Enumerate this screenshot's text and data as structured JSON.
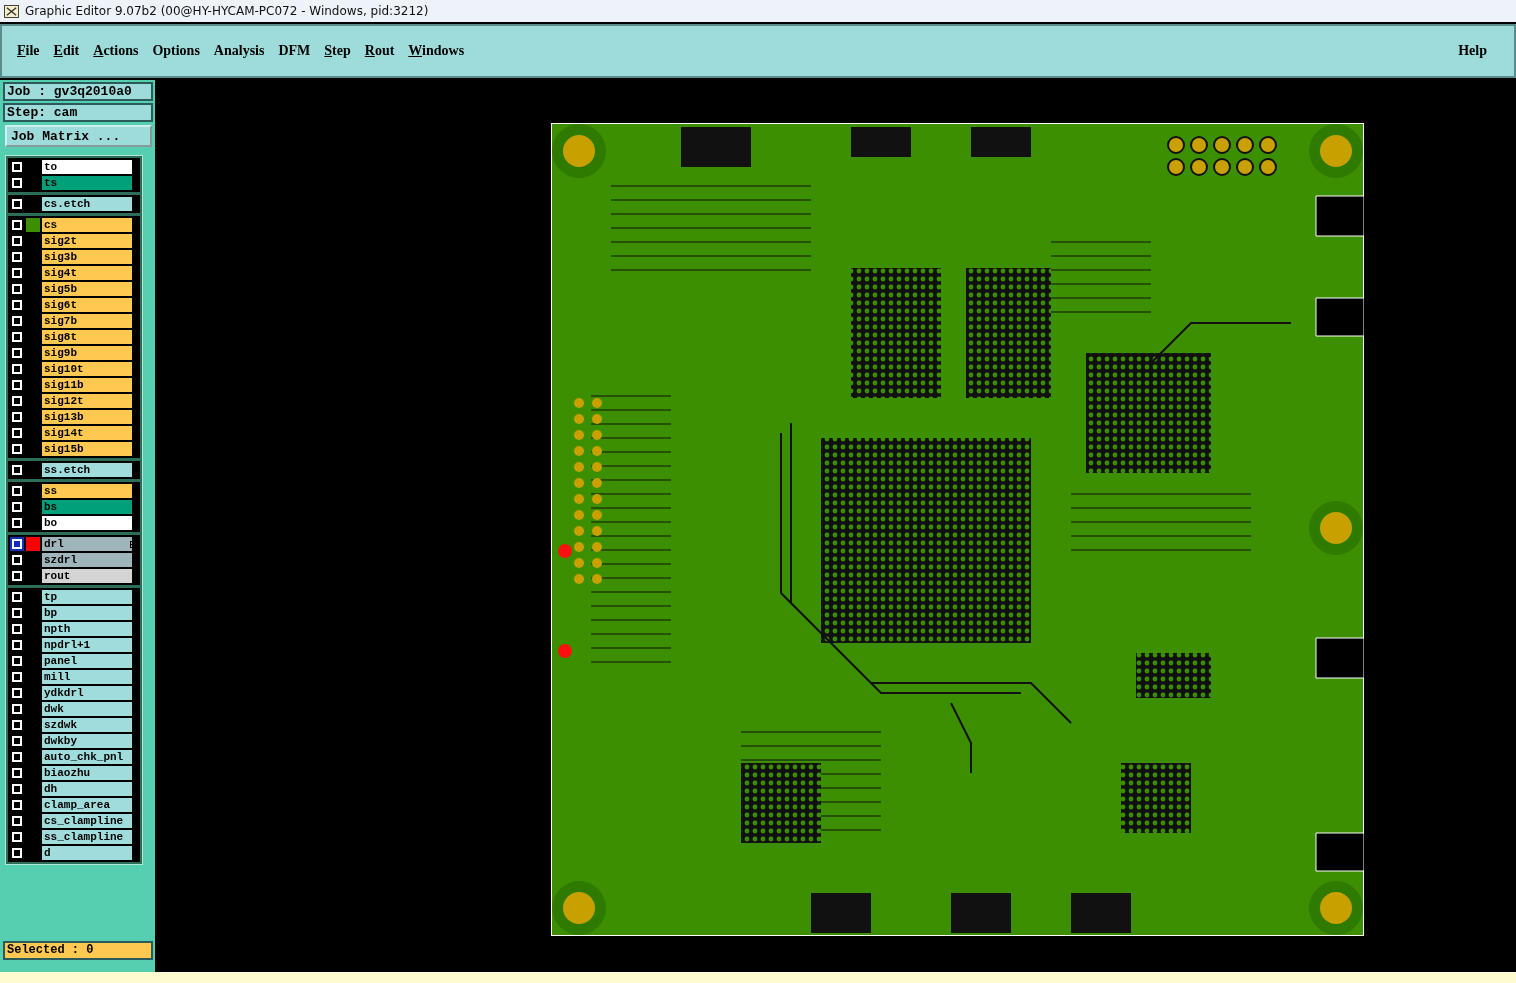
{
  "window": {
    "title": "Graphic Editor 9.07b2 (00@HY-HYCAM-PC072 - Windows, pid:3212)"
  },
  "menu": [
    {
      "label": "File",
      "mnemonic": true
    },
    {
      "label": "Edit",
      "mnemonic": true
    },
    {
      "label": "Actions",
      "mnemonic": true
    },
    {
      "label": "Options",
      "mnemonic": false
    },
    {
      "label": "Analysis",
      "mnemonic": false
    },
    {
      "label": "DFM",
      "mnemonic": false
    },
    {
      "label": "Step",
      "mnemonic": true
    },
    {
      "label": "Rout",
      "mnemonic": true
    },
    {
      "label": "Windows",
      "mnemonic": true
    }
  ],
  "help": "Help",
  "job": "Job : gv3q2010a0",
  "step": "Step: cam",
  "job_matrix": "Job Matrix ...",
  "layer_groups": [
    [
      {
        "name": "to",
        "color": "#ffffff",
        "selected": false
      },
      {
        "name": "ts",
        "color": "#00a07a",
        "selected": false
      }
    ],
    [
      {
        "name": "cs.etch",
        "color": "#a0dcdc",
        "selected": false
      }
    ],
    [
      {
        "name": "cs",
        "color": "#ffc850",
        "selected": false,
        "swatch": {
          "color": "#3c9000"
        }
      },
      {
        "name": "sig2t",
        "color": "#ffc850",
        "selected": false
      },
      {
        "name": "sig3b",
        "color": "#ffc850",
        "selected": false
      },
      {
        "name": "sig4t",
        "color": "#ffc850",
        "selected": false
      },
      {
        "name": "sig5b",
        "color": "#ffc850",
        "selected": false
      },
      {
        "name": "sig6t",
        "color": "#ffc850",
        "selected": false
      },
      {
        "name": "sig7b",
        "color": "#ffc850",
        "selected": false
      },
      {
        "name": "sig8t",
        "color": "#ffc850",
        "selected": false
      },
      {
        "name": "sig9b",
        "color": "#ffc850",
        "selected": false
      },
      {
        "name": "sig10t",
        "color": "#ffc850",
        "selected": false
      },
      {
        "name": "sig11b",
        "color": "#ffc850",
        "selected": false
      },
      {
        "name": "sig12t",
        "color": "#ffc850",
        "selected": false
      },
      {
        "name": "sig13b",
        "color": "#ffc850",
        "selected": false
      },
      {
        "name": "sig14t",
        "color": "#ffc850",
        "selected": false
      },
      {
        "name": "sig15b",
        "color": "#ffc850",
        "selected": false
      }
    ],
    [
      {
        "name": "ss.etch",
        "color": "#a0dcdc",
        "selected": false
      }
    ],
    [
      {
        "name": "ss",
        "color": "#ffc850",
        "selected": false
      },
      {
        "name": "bs",
        "color": "#00a07a",
        "selected": false
      },
      {
        "name": "bo",
        "color": "#ffffff",
        "selected": false
      }
    ],
    [
      {
        "name": "drl",
        "color": "#a0b4bc",
        "selected": true,
        "swatch": {
          "color": "#ff0000"
        }
      },
      {
        "name": "szdrl",
        "color": "#a0b4bc",
        "selected": false
      },
      {
        "name": "rout",
        "color": "#d4d4d4",
        "selected": false
      }
    ],
    [
      {
        "name": "tp",
        "color": "#a0dcdc",
        "selected": false
      },
      {
        "name": "bp",
        "color": "#a0dcdc",
        "selected": false
      },
      {
        "name": "npth",
        "color": "#a0dcdc",
        "selected": false
      },
      {
        "name": "npdrl+1",
        "color": "#a0dcdc",
        "selected": false
      },
      {
        "name": "panel",
        "color": "#a0dcdc",
        "selected": false
      },
      {
        "name": "mill",
        "color": "#a0dcdc",
        "selected": false
      },
      {
        "name": "ydkdrl",
        "color": "#a0dcdc",
        "selected": false
      },
      {
        "name": "dwk",
        "color": "#a0dcdc",
        "selected": false
      },
      {
        "name": "szdwk",
        "color": "#a0dcdc",
        "selected": false
      },
      {
        "name": "dwkby",
        "color": "#a0dcdc",
        "selected": false
      },
      {
        "name": "auto_chk_pnl",
        "color": "#a0dcdc",
        "selected": false
      },
      {
        "name": "biaozhu",
        "color": "#a0dcdc",
        "selected": false
      },
      {
        "name": "dh",
        "color": "#a0dcdc",
        "selected": false
      },
      {
        "name": "clamp_area",
        "color": "#a0dcdc",
        "selected": false
      },
      {
        "name": "cs_clampline",
        "color": "#a0dcdc",
        "selected": false
      },
      {
        "name": "ss_clampline",
        "color": "#a0dcdc",
        "selected": false
      },
      {
        "name": "d",
        "color": "#a0dcdc",
        "selected": false
      }
    ]
  ],
  "selected_count": "Selected : 0"
}
